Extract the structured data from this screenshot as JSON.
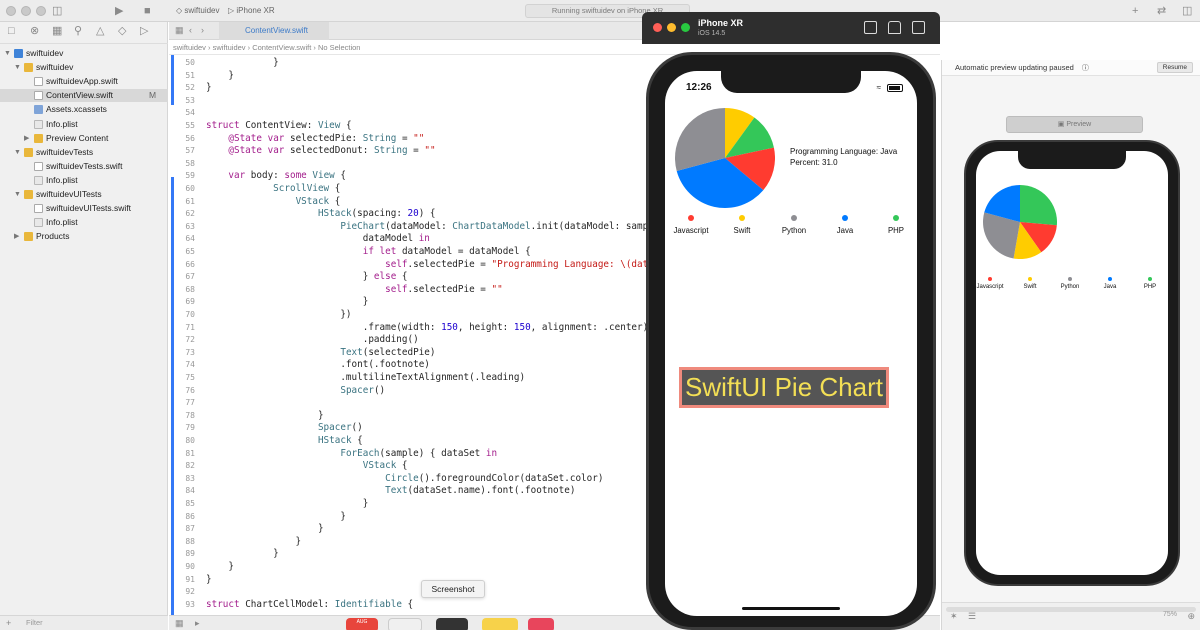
{
  "toolbar": {
    "scheme": "swiftuidev",
    "device": "iPhone XR",
    "status": "Running swiftuidev on iPhone XR"
  },
  "navigator": {
    "items": [
      {
        "label": "swiftuidev",
        "kind": "project",
        "depth": 0,
        "disclosure": "open",
        "badge": "",
        "selected": false
      },
      {
        "label": "swiftuidev",
        "kind": "folder",
        "depth": 1,
        "disclosure": "open",
        "badge": "",
        "selected": false
      },
      {
        "label": "swiftuidevApp.swift",
        "kind": "swift",
        "depth": 2,
        "disclosure": "",
        "badge": "",
        "selected": false
      },
      {
        "label": "ContentView.swift",
        "kind": "swift",
        "depth": 2,
        "disclosure": "",
        "badge": "M",
        "selected": true
      },
      {
        "label": "Assets.xcassets",
        "kind": "assets",
        "depth": 2,
        "disclosure": "",
        "badge": "",
        "selected": false
      },
      {
        "label": "Info.plist",
        "kind": "plist",
        "depth": 2,
        "disclosure": "",
        "badge": "",
        "selected": false
      },
      {
        "label": "Preview Content",
        "kind": "folder",
        "depth": 2,
        "disclosure": "closed",
        "badge": "",
        "selected": false
      },
      {
        "label": "swiftuidevTests",
        "kind": "folder",
        "depth": 1,
        "disclosure": "open",
        "badge": "",
        "selected": false
      },
      {
        "label": "swiftuidevTests.swift",
        "kind": "swift",
        "depth": 2,
        "disclosure": "",
        "badge": "",
        "selected": false
      },
      {
        "label": "Info.plist",
        "kind": "plist",
        "depth": 2,
        "disclosure": "",
        "badge": "",
        "selected": false
      },
      {
        "label": "swiftuidevUITests",
        "kind": "folder",
        "depth": 1,
        "disclosure": "open",
        "badge": "",
        "selected": false
      },
      {
        "label": "swiftuidevUITests.swift",
        "kind": "swift",
        "depth": 2,
        "disclosure": "",
        "badge": "",
        "selected": false
      },
      {
        "label": "Info.plist",
        "kind": "plist",
        "depth": 2,
        "disclosure": "",
        "badge": "",
        "selected": false
      },
      {
        "label": "Products",
        "kind": "folder",
        "depth": 1,
        "disclosure": "closed",
        "badge": "",
        "selected": false
      }
    ],
    "filter_placeholder": "Filter"
  },
  "editor": {
    "tab_label": "ContentView.swift",
    "jump_bar": [
      "swiftuidev",
      "swiftuidev",
      "ContentView.swift",
      "No Selection"
    ],
    "lines": [
      {
        "n": "50",
        "t": "            }"
      },
      {
        "n": "51",
        "t": "    }"
      },
      {
        "n": "52",
        "t": "}"
      },
      {
        "n": "53",
        "t": ""
      },
      {
        "n": "54",
        "t": ""
      },
      {
        "n": "55",
        "t": "struct ContentView: View {"
      },
      {
        "n": "56",
        "t": "    @State var selectedPie: String = \"\""
      },
      {
        "n": "57",
        "t": "    @State var selectedDonut: String = \"\""
      },
      {
        "n": "58",
        "t": ""
      },
      {
        "n": "59",
        "t": "    var body: some View {"
      },
      {
        "n": "60",
        "t": "            ScrollView {"
      },
      {
        "n": "61",
        "t": "                VStack {"
      },
      {
        "n": "62",
        "t": "                    HStack(spacing: 20) {"
      },
      {
        "n": "63",
        "t": "                        PieChart(dataModel: ChartDataModel.init(dataModel: sample), onTap: {"
      },
      {
        "n": "64",
        "t": "                            dataModel in"
      },
      {
        "n": "65",
        "t": "                            if let dataModel = dataModel {"
      },
      {
        "n": "66",
        "t": "                                self.selectedPie = \"Programming Language: \\(dataModel.name)\\nPercent: \\(dataModel.value)\""
      },
      {
        "n": "67",
        "t": "                            } else {"
      },
      {
        "n": "68",
        "t": "                                self.selectedPie = \"\""
      },
      {
        "n": "69",
        "t": "                            }"
      },
      {
        "n": "70",
        "t": "                        })"
      },
      {
        "n": "71",
        "t": "                            .frame(width: 150, height: 150, alignment: .center)"
      },
      {
        "n": "72",
        "t": "                            .padding()"
      },
      {
        "n": "73",
        "t": "                        Text(selectedPie)"
      },
      {
        "n": "74",
        "t": "                        .font(.footnote)"
      },
      {
        "n": "75",
        "t": "                        .multilineTextAlignment(.leading)"
      },
      {
        "n": "76",
        "t": "                        Spacer()"
      },
      {
        "n": "77",
        "t": ""
      },
      {
        "n": "78",
        "t": "                    }"
      },
      {
        "n": "79",
        "t": "                    Spacer()"
      },
      {
        "n": "80",
        "t": "                    HStack {"
      },
      {
        "n": "81",
        "t": "                        ForEach(sample) { dataSet in"
      },
      {
        "n": "82",
        "t": "                            VStack {"
      },
      {
        "n": "83",
        "t": "                                Circle().foregroundColor(dataSet.color)"
      },
      {
        "n": "84",
        "t": "                                Text(dataSet.name).font(.footnote)"
      },
      {
        "n": "85",
        "t": "                            }"
      },
      {
        "n": "86",
        "t": "                        }"
      },
      {
        "n": "87",
        "t": "                    }"
      },
      {
        "n": "88",
        "t": "                }"
      },
      {
        "n": "89",
        "t": "            }"
      },
      {
        "n": "90",
        "t": "    }"
      },
      {
        "n": "91",
        "t": "}"
      },
      {
        "n": "92",
        "t": ""
      },
      {
        "n": "93",
        "t": "struct ChartCellModel: Identifiable {"
      }
    ]
  },
  "tooltip": "Screenshot",
  "dock": {
    "calendar_month": "AUG"
  },
  "simulator": {
    "title": "iPhone XR",
    "subtitle": "iOS 14.5",
    "status_time": "12:26",
    "selected_info": [
      "Programming Language: Java",
      "Percent: 31.0"
    ],
    "legend": [
      {
        "name": "Javascript",
        "color": "#ff3b30"
      },
      {
        "name": "Swift",
        "color": "#ffcc00"
      },
      {
        "name": "Python",
        "color": "#8e8e93"
      },
      {
        "name": "Java",
        "color": "#007aff"
      },
      {
        "name": "PHP",
        "color": "#34c759"
      }
    ],
    "pie_slices": [
      {
        "name": "Swift",
        "color": "#ffcc00",
        "start": 0,
        "end": 36
      },
      {
        "name": "PHP",
        "color": "#34c759",
        "start": 36,
        "end": 78
      },
      {
        "name": "Javascript",
        "color": "#ff3b30",
        "start": 78,
        "end": 130
      },
      {
        "name": "Java",
        "color": "#007aff",
        "start": 130,
        "end": 255
      },
      {
        "name": "Python",
        "color": "#8e8e93",
        "start": 255,
        "end": 360
      }
    ],
    "banner": "SwiftUI Pie Chart"
  },
  "canvas": {
    "status": "Automatic preview updating paused",
    "resume_label": "Resume",
    "preview_label": "Preview",
    "zoom": "75%",
    "pie_slices": [
      {
        "name": "PHP",
        "color": "#34c759",
        "start": 0,
        "end": 95
      },
      {
        "name": "Javascript",
        "color": "#ff3b30",
        "start": 95,
        "end": 145
      },
      {
        "name": "Swift",
        "color": "#ffcc00",
        "start": 145,
        "end": 190
      },
      {
        "name": "Python",
        "color": "#8e8e93",
        "start": 190,
        "end": 285
      },
      {
        "name": "Java",
        "color": "#007aff",
        "start": 285,
        "end": 360
      }
    ]
  }
}
